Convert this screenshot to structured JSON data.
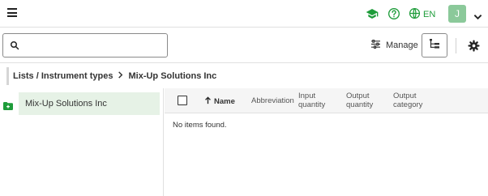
{
  "header": {
    "language": "EN",
    "avatar_initial": "J",
    "accent_color": "#1e9c3a",
    "icons": [
      "menu-icon",
      "graduation-cap-icon",
      "help-icon",
      "globe-icon",
      "chevron-down-icon"
    ]
  },
  "toolbar": {
    "search_value": "",
    "manage_label": "Manage"
  },
  "breadcrumb": {
    "path": "Lists / Instrument types",
    "current": "Mix-Up Solutions Inc"
  },
  "tree": {
    "nodes": [
      {
        "label": "Mix-Up Solutions Inc",
        "selected": true
      }
    ]
  },
  "table": {
    "columns": {
      "name": "Name",
      "abbreviation": "Abbreviation",
      "input_quantity": [
        "Input",
        "quantity"
      ],
      "output_quantity": [
        "Output",
        "quantity"
      ],
      "output_category": [
        "Output",
        "category"
      ]
    },
    "sort": {
      "column": "Name",
      "direction": "ascending"
    },
    "empty_message": "No items found."
  }
}
